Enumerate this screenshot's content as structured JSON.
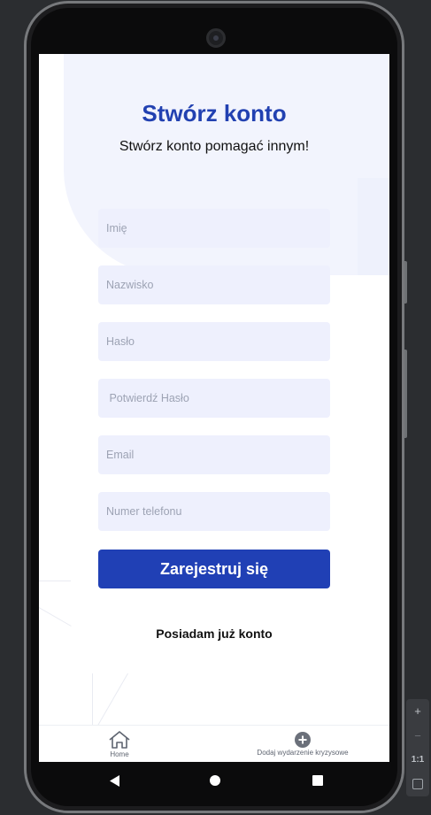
{
  "screen": {
    "title": "Stwórz konto",
    "subtitle": "Stwórz konto pomagać innym!"
  },
  "form": {
    "first_name_placeholder": "Imię",
    "last_name_placeholder": "Nazwisko",
    "password_placeholder": "Hasło",
    "confirm_password_placeholder": " Potwierdź Hasło",
    "email_placeholder": "Email",
    "phone_placeholder": "Numer telefonu",
    "register_label": "Zarejestruj się",
    "login_link_label": "Posiadam już konto"
  },
  "bottom_nav": {
    "items": [
      {
        "label": "Home",
        "icon": "home-icon"
      },
      {
        "label": "Dodaj wydarzenie kryzysowe",
        "icon": "add-circle-icon"
      }
    ]
  },
  "emulator_toolbar": {
    "zoom_in": "+",
    "zoom_out": "−",
    "actual_size": "1:1"
  },
  "colors": {
    "accent": "#2040b5",
    "field_bg": "#eef0fd"
  }
}
